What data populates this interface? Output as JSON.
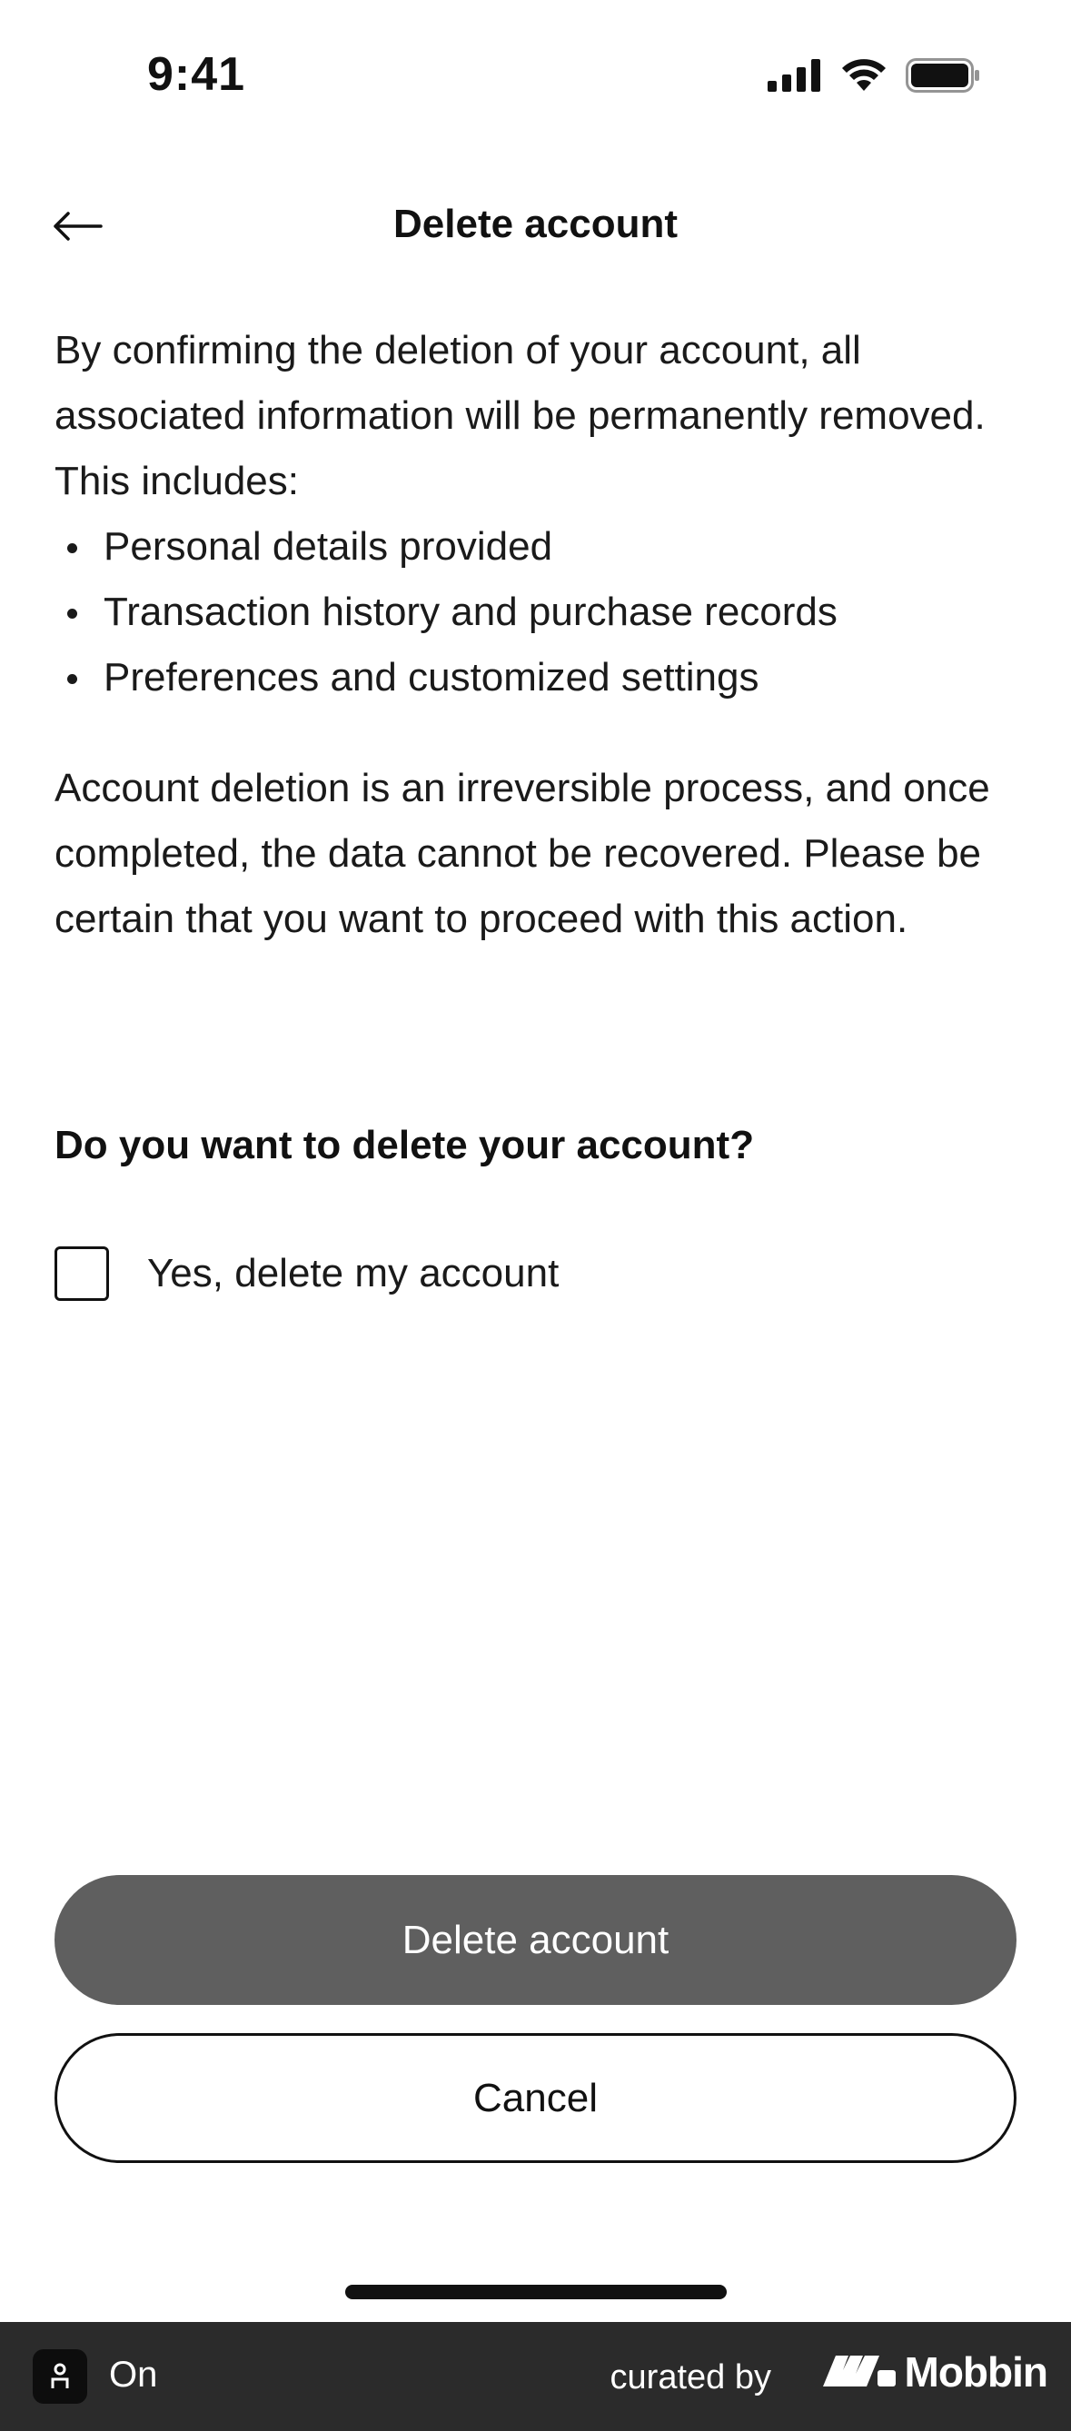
{
  "status_bar": {
    "time": "9:41"
  },
  "nav": {
    "title": "Delete account"
  },
  "body": {
    "intro": "By confirming the deletion of your account, all associated information will be permanently removed. This includes:",
    "items": [
      {
        "label": "Personal details provided"
      },
      {
        "label": "Transaction history and purchase records"
      },
      {
        "label": "Preferences and customized settings"
      }
    ],
    "warning": "Account deletion is an irreversible process, and once completed, the data cannot be recovered. Please be certain that you want to proceed with this action."
  },
  "confirm": {
    "question": "Do you want to delete your account?",
    "checkbox_label": "Yes, delete my account",
    "checked": false
  },
  "actions": {
    "delete_label": "Delete account",
    "cancel_label": "Cancel"
  },
  "footer": {
    "app_name": "On",
    "curated_by": "curated by",
    "brand": "Mobbin"
  },
  "colors": {
    "delete_button_bg": "#5f5f5f",
    "footer_bg": "#2b2b2b",
    "text": "#111111"
  },
  "icons": {
    "back": "arrow-left-icon",
    "signal": "cellular-signal-icon",
    "wifi": "wifi-icon",
    "battery": "battery-icon"
  }
}
